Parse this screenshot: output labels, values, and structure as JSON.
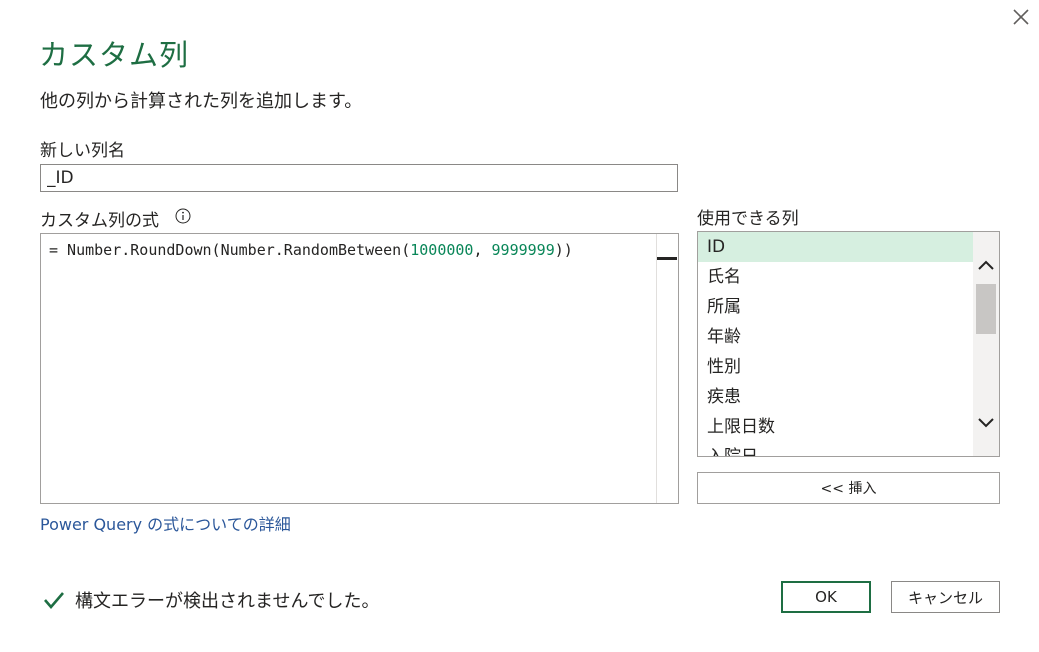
{
  "dialog": {
    "title": "カスタム列",
    "description": "他の列から計算された列を追加します。"
  },
  "new_column": {
    "label": "新しい列名",
    "value": "_ID"
  },
  "formula": {
    "label": "カスタム列の式",
    "prefix": "= Number.RoundDown(Number.RandomBetween(",
    "num1": "1000000",
    "sep": ", ",
    "num2": "9999999",
    "suffix": "))"
  },
  "available_columns": {
    "label": "使用できる列",
    "items": [
      "ID",
      "氏名",
      "所属",
      "年齢",
      "性別",
      "疾患",
      "上限日数",
      "入院日"
    ],
    "selected_index": 0
  },
  "insert_label": "<< 挿入",
  "learn_link": "Power Query の式についての詳細",
  "status": "構文エラーが検出されませんでした。",
  "ok_label": "OK",
  "cancel_label": "キャンセル",
  "colors": {
    "accent": "#1e6e43",
    "selected_bg": "#d6efe0",
    "link": "#2b579a",
    "number": "#098658"
  },
  "icons": [
    "close-icon",
    "info-icon",
    "chevron-up-icon",
    "chevron-down-icon",
    "checkmark-icon"
  ]
}
